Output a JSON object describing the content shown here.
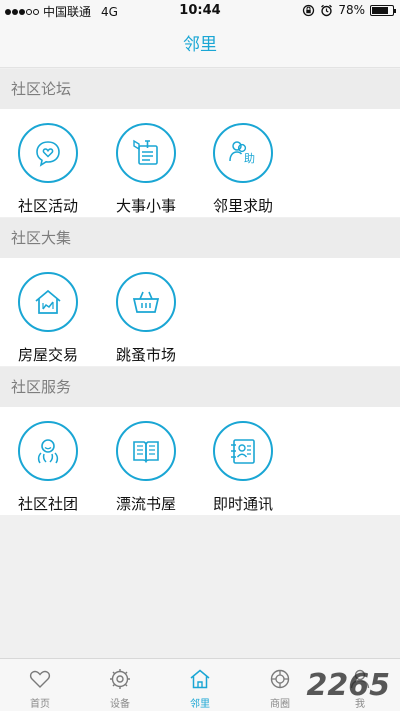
{
  "status_bar": {
    "carrier": "中国联通",
    "network": "4G",
    "time": "10:44",
    "battery": "78%",
    "battery_level": 0.78
  },
  "nav": {
    "title": "邻里"
  },
  "sections": [
    {
      "title": "社区论坛",
      "items": [
        {
          "label": "社区活动",
          "icon": "heart-chat-icon"
        },
        {
          "label": "大事小事",
          "icon": "bulletin-icon"
        },
        {
          "label": "邻里求助",
          "icon": "help-people-icon"
        }
      ]
    },
    {
      "title": "社区大集",
      "items": [
        {
          "label": "房屋交易",
          "icon": "house-icon"
        },
        {
          "label": "跳蚤市场",
          "icon": "basket-icon"
        }
      ]
    },
    {
      "title": "社区服务",
      "items": [
        {
          "label": "社区社团",
          "icon": "group-icon"
        },
        {
          "label": "漂流书屋",
          "icon": "book-icon"
        },
        {
          "label": "即时通讯",
          "icon": "contact-card-icon"
        }
      ]
    }
  ],
  "tabs": [
    {
      "label": "首页",
      "icon": "heart-icon"
    },
    {
      "label": "设备",
      "icon": "gear-icon"
    },
    {
      "label": "邻里",
      "icon": "home-icon",
      "active": true
    },
    {
      "label": "商圈",
      "icon": "shop-icon"
    },
    {
      "label": "我",
      "icon": "user-icon"
    }
  ],
  "colors": {
    "accent": "#1aa6d4",
    "section_bg": "#ececec",
    "section_text": "#7d7d7d"
  },
  "watermark": "2265"
}
